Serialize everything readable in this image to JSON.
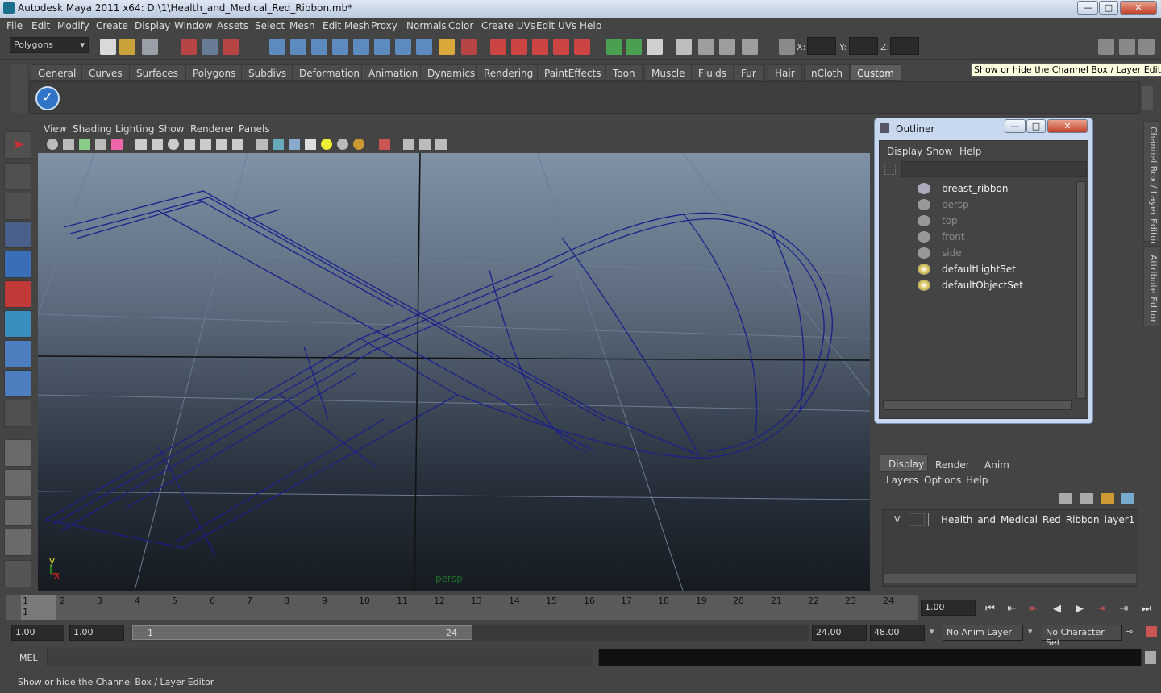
{
  "window": {
    "title": "Autodesk Maya 2011 x64: D:\\1\\Health_and_Medical_Red_Ribbon.mb*",
    "min": "—",
    "max": "□",
    "close": "✕"
  },
  "menubar": [
    "File",
    "Edit",
    "Modify",
    "Create",
    "Display",
    "Window",
    "Assets",
    "Select",
    "Mesh",
    "Edit Mesh",
    "Proxy",
    "Normals",
    "Color",
    "Create UVs",
    "Edit UVs",
    "Help"
  ],
  "status": {
    "mode": "Polygons",
    "x_label": "X:",
    "y_label": "Y:",
    "z_label": "Z:"
  },
  "shelf_tabs": [
    "General",
    "Curves",
    "Surfaces",
    "Polygons",
    "Subdivs",
    "Deformation",
    "Animation",
    "Dynamics",
    "Rendering",
    "PaintEffects",
    "Toon",
    "Muscle",
    "Fluids",
    "Fur",
    "Hair",
    "nCloth",
    "Custom"
  ],
  "shelf_active": "Custom",
  "tooltip": "Show or hide the Channel Box / Layer Editor",
  "viewport": {
    "menus": [
      "View",
      "Shading",
      "Lighting",
      "Show",
      "Renderer",
      "Panels"
    ],
    "camera_label": "persp",
    "axis_y": "y",
    "axis_x": "x"
  },
  "outliner": {
    "title": "Outliner",
    "menus": [
      "Display",
      "Show",
      "Help"
    ],
    "items": [
      {
        "label": "breast_ribbon",
        "dim": false
      },
      {
        "label": "persp",
        "dim": true
      },
      {
        "label": "top",
        "dim": true
      },
      {
        "label": "front",
        "dim": true
      },
      {
        "label": "side",
        "dim": true
      },
      {
        "label": "defaultLightSet",
        "dim": false
      },
      {
        "label": "defaultObjectSet",
        "dim": false
      }
    ]
  },
  "side_tabs": {
    "channel": "Channel Box / Layer Editor",
    "attribute": "Attribute Editor"
  },
  "layer_editor": {
    "tabs": [
      "Display",
      "Render",
      "Anim"
    ],
    "menus": [
      "Layers",
      "Options",
      "Help"
    ],
    "layer_v": "V",
    "layer_name": "Health_and_Medical_Red_Ribbon_layer1"
  },
  "timeline": {
    "ticks": [
      "1",
      "2",
      "3",
      "4",
      "5",
      "6",
      "7",
      "8",
      "9",
      "10",
      "11",
      "12",
      "13",
      "14",
      "15",
      "16",
      "17",
      "18",
      "19",
      "20",
      "21",
      "22",
      "23",
      "24"
    ],
    "current_frame_marker": "1",
    "current_time": "1.00"
  },
  "range": {
    "start": "1.00",
    "anim_start": "1.00",
    "slider_start": "1",
    "slider_end": "24",
    "end": "24.00",
    "anim_end": "48.00",
    "anim_layer": "No Anim Layer",
    "char_set": "No Character Set"
  },
  "command": {
    "label": "MEL"
  },
  "help_line": "Show or hide the Channel Box / Layer Editor"
}
